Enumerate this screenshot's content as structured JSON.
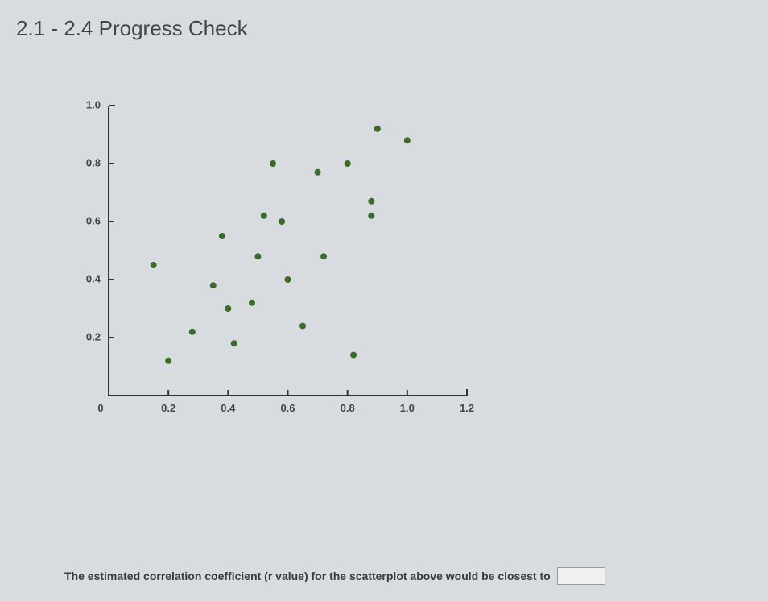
{
  "header": {
    "title": "2.1 - 2.4 Progress Check"
  },
  "question": {
    "prompt": "The estimated correlation coefficient (r value) for the scatterplot above would be closest to",
    "answer_value": ""
  },
  "chart_data": {
    "type": "scatter",
    "title": "",
    "xlabel": "",
    "ylabel": "",
    "xlim": [
      0,
      1.2
    ],
    "ylim": [
      0,
      1.0
    ],
    "xticks": [
      0,
      0.2,
      0.4,
      0.6,
      0.8,
      1.0,
      1.2
    ],
    "xtick_labels": [
      "0",
      "0.2",
      "0.4",
      "0.6",
      "0.8",
      "1.0",
      "1.2"
    ],
    "yticks": [
      0.2,
      0.4,
      0.6,
      0.8,
      1.0
    ],
    "ytick_labels": [
      "0.2",
      "0.4",
      "0.6",
      "0.8",
      "1.0"
    ],
    "series": [
      {
        "name": "data",
        "points": [
          {
            "x": 0.15,
            "y": 0.45
          },
          {
            "x": 0.2,
            "y": 0.12
          },
          {
            "x": 0.28,
            "y": 0.22
          },
          {
            "x": 0.35,
            "y": 0.38
          },
          {
            "x": 0.38,
            "y": 0.55
          },
          {
            "x": 0.4,
            "y": 0.3
          },
          {
            "x": 0.42,
            "y": 0.18
          },
          {
            "x": 0.48,
            "y": 0.32
          },
          {
            "x": 0.5,
            "y": 0.48
          },
          {
            "x": 0.52,
            "y": 0.62
          },
          {
            "x": 0.55,
            "y": 0.8
          },
          {
            "x": 0.58,
            "y": 0.6
          },
          {
            "x": 0.6,
            "y": 0.4
          },
          {
            "x": 0.65,
            "y": 0.24
          },
          {
            "x": 0.7,
            "y": 0.77
          },
          {
            "x": 0.72,
            "y": 0.48
          },
          {
            "x": 0.8,
            "y": 0.8
          },
          {
            "x": 0.82,
            "y": 0.14
          },
          {
            "x": 0.88,
            "y": 0.62
          },
          {
            "x": 0.88,
            "y": 0.67
          },
          {
            "x": 0.9,
            "y": 0.92
          },
          {
            "x": 1.0,
            "y": 0.88
          }
        ]
      }
    ]
  }
}
